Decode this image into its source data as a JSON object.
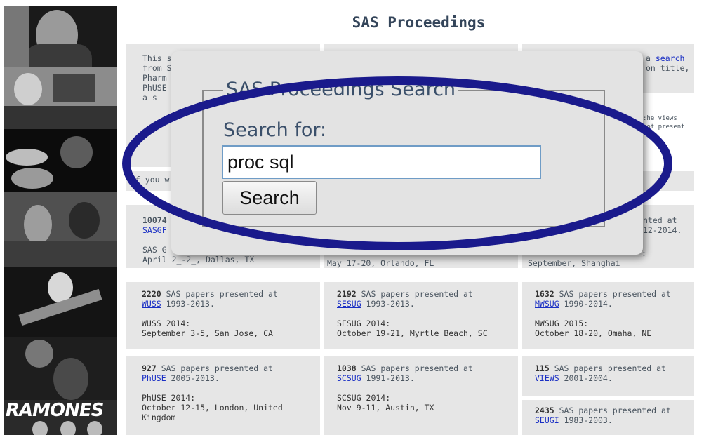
{
  "page": {
    "title": "SAS Proceedings"
  },
  "fragments": {
    "intro_lines": [
      "This s",
      "from S",
      "Pharm",
      "PhUSE",
      "a s"
    ],
    "search_link": "search",
    "search_suffix": "a",
    "right_lines": [
      "on title,"
    ],
    "views_lines": [
      ":he views",
      "not present"
    ],
    "ifyou": "If you w",
    "sasgf_count": "10074",
    "sasgf_link": "SASGF",
    "sasgf_event": "SAS G",
    "sasgf_date": "April 2_-2_, Dallas, TX",
    "mid_date": "May 17-20, Orlando, FL",
    "right_frag1": "nted at",
    "right_frag2": "12-2014.",
    "right_frag3": ":",
    "right_date": "September, Shanghai"
  },
  "cards": [
    {
      "count": "2220",
      "text": " SAS papers presented at",
      "link": "WUSS",
      "years": " 1993-2013.",
      "event": "WUSS 2014:",
      "details": "September 3-5, San Jose, CA"
    },
    {
      "count": "2192",
      "text": " SAS papers presented at",
      "link": "SESUG",
      "years": " 1993-2013.",
      "event": "SESUG 2014:",
      "details": "October 19-21, Myrtle Beach, SC"
    },
    {
      "count": "1632",
      "text": " SAS papers presented at",
      "link": "MWSUG",
      "years": " 1990-2014.",
      "event": "MWSUG 2015:",
      "details": "October 18-20, Omaha, NE"
    },
    {
      "count": "927",
      "text": " SAS papers presented at",
      "link": "PhUSE",
      "years": " 2005-2013.",
      "event": "PhUSE 2014:",
      "details": "October 12-15, London, United Kingdom"
    },
    {
      "count": "1038",
      "text": " SAS papers presented at",
      "link": "SCSUG",
      "years": " 1991-2013.",
      "event": "SCSUG 2014:",
      "details": "Nov 9-11, Austin, TX"
    },
    {
      "count": "115",
      "text": " SAS papers presented at",
      "link": "VIEWS",
      "years": " 2001-2004.",
      "event": "",
      "details": ""
    }
  ],
  "extra_card": {
    "count": "2435",
    "text": " SAS papers presented at",
    "link": "SEUGI",
    "years": " 1983-2003."
  },
  "search": {
    "legend": "SAS Proceedings Search",
    "label": "Search for:",
    "value": "proc sql",
    "button": "Search"
  },
  "sidebar": {
    "banner_text": "RAMONES"
  },
  "colors": {
    "title": "#34455a",
    "link": "#1a2fc4",
    "panel": "#e6e6e6",
    "annotation": "#1a1a8c"
  }
}
